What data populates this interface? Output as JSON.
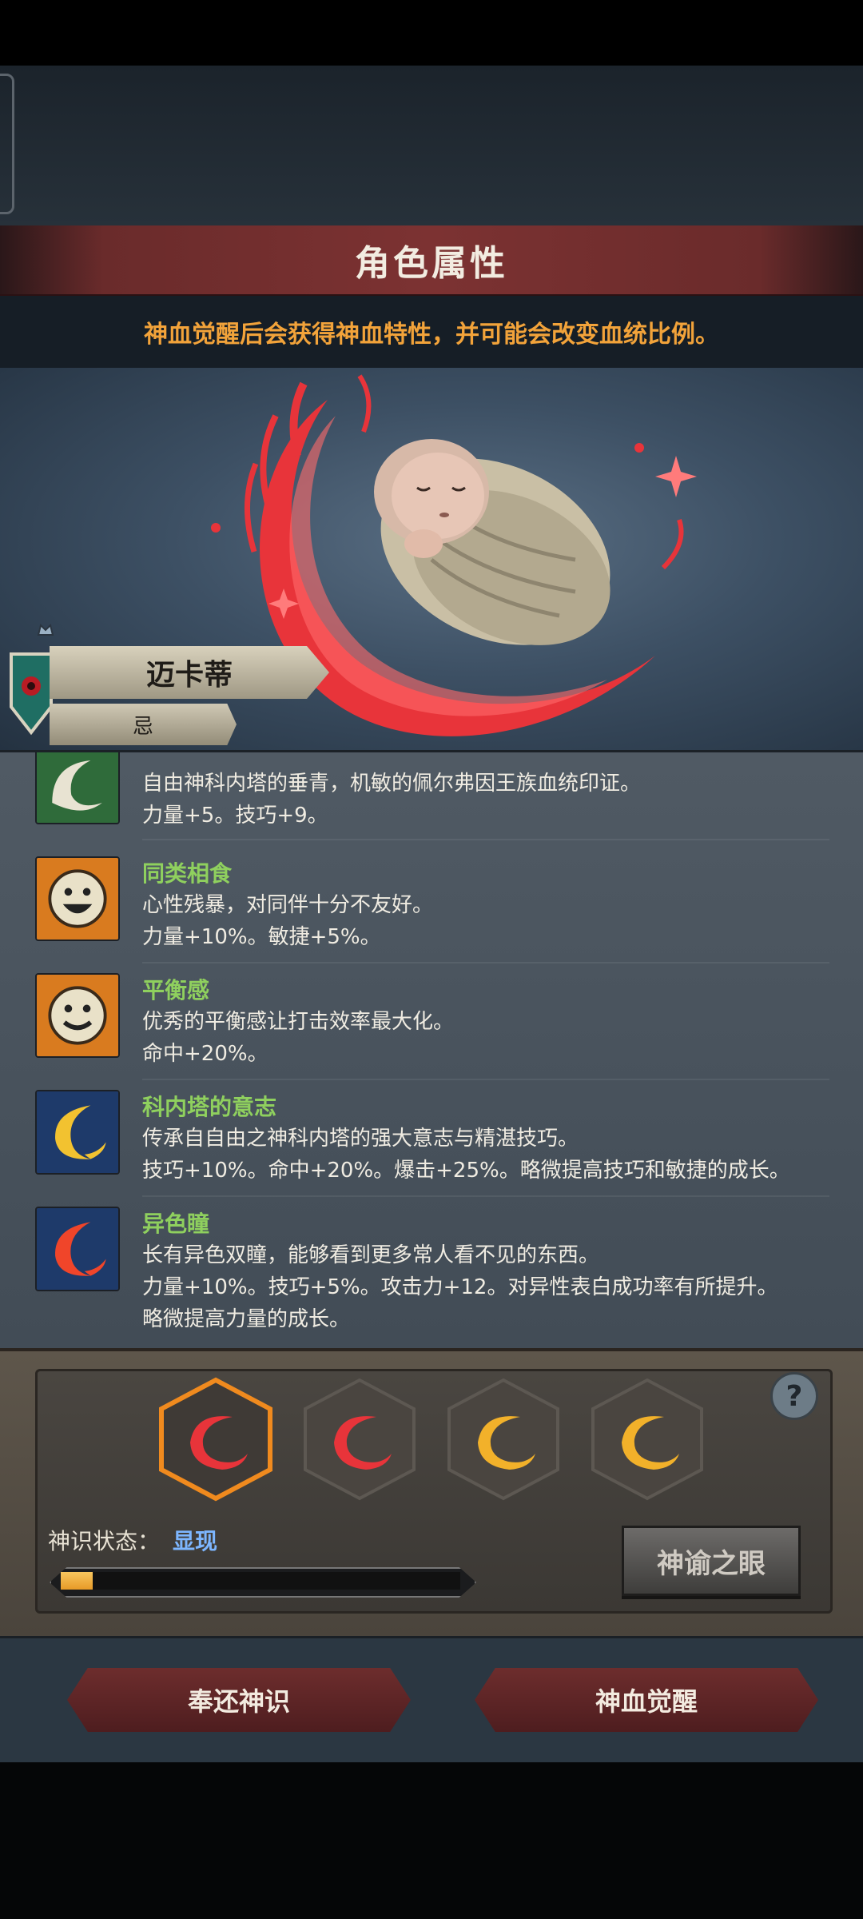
{
  "header": {
    "title": "角色属性",
    "subtitle": "神血觉醒后会获得神血特性，并可能会改变血统比例。"
  },
  "character": {
    "name": "迈卡蒂",
    "tag": "忌"
  },
  "traits": [
    {
      "name": "",
      "desc": "自由神科内塔的垂青，机敏的佩尔弗因王族血统印证。",
      "stats": "力量+5。技巧+9。",
      "extra": "",
      "icon": "white-swirl-icon"
    },
    {
      "name": "同类相食",
      "desc": "心性残暴，对同伴十分不友好。",
      "stats": "力量+10%。敏捷+5%。",
      "extra": "",
      "icon": "grin-face-icon"
    },
    {
      "name": "平衡感",
      "desc": "优秀的平衡感让打击效率最大化。",
      "stats": "命中+20%。",
      "extra": "",
      "icon": "smile-face-icon"
    },
    {
      "name": "科内塔的意志",
      "desc": "传承自自由之神科内塔的强大意志与精湛技巧。",
      "stats": "技巧+10%。命中+20%。爆击+25%。略微提高技巧和敏捷的成长。",
      "extra": "",
      "icon": "gold-crescent-icon"
    },
    {
      "name": "异色瞳",
      "desc": "长有异色双瞳，能够看到更多常人看不见的东西。",
      "stats": "力量+10%。技巧+5%。攻击力+12。对异性表白成功率有所提升。",
      "extra": "略微提高力量的成长。",
      "icon": "red-crescent-icon"
    }
  ],
  "awaken_panel": {
    "slots": [
      {
        "color": "red",
        "selected": true
      },
      {
        "color": "red",
        "selected": false
      },
      {
        "color": "gold",
        "selected": false
      },
      {
        "color": "gold",
        "selected": false
      }
    ],
    "help_label": "?",
    "state_label": "神识状态：",
    "state_value": "显现",
    "progress": 0.08,
    "oracle_button": "神谕之眼"
  },
  "actions": {
    "return_label": "奉还神识",
    "awaken_label": "神血觉醒"
  },
  "colors": {
    "accent_orange": "#f2a33a",
    "trait_green": "#8fd05e",
    "state_blue": "#7db6ff",
    "banner_red": "#7c3232"
  }
}
